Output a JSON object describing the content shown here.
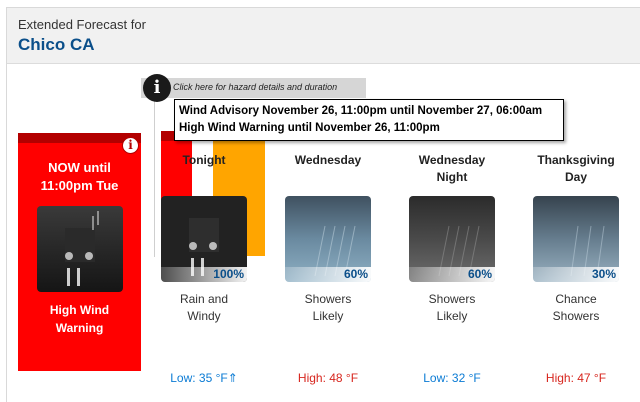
{
  "header": {
    "title_small": "Extended Forecast for",
    "title_big": "Chico CA"
  },
  "hazard": {
    "tab_text": "Click here for hazard details and duration",
    "popup_lines": [
      "Wind Advisory November 26, 11:00pm until November 27, 06:00am",
      "High Wind Warning until November 26, 11:00pm"
    ],
    "icon": "info-icon"
  },
  "now": {
    "title": "NOW until 11:00pm Tue",
    "title_l1": "NOW until",
    "title_l2": "11:00pm Tue",
    "desc_l1": "High Wind",
    "desc_l2": "Warning",
    "icon": "night-rain-icon",
    "color": "#ff0000"
  },
  "periods": [
    {
      "name_l1": "Tonight",
      "name_l2": "",
      "pop": "100%",
      "short_l1": "Rain and",
      "short_l2": "Windy",
      "temp": "Low: 35 °F⇑",
      "temp_type": "low"
    },
    {
      "name_l1": "Wednesday",
      "name_l2": "",
      "pop": "60%",
      "short_l1": "Showers",
      "short_l2": "Likely",
      "temp": "High: 48 °F",
      "temp_type": "high"
    },
    {
      "name_l1": "Wednesday",
      "name_l2": "Night",
      "pop": "60%",
      "short_l1": "Showers",
      "short_l2": "Likely",
      "temp": "Low: 32 °F",
      "temp_type": "low"
    },
    {
      "name_l1": "Thanksgiving",
      "name_l2": "Day",
      "pop": "30%",
      "short_l1": "Chance",
      "short_l2": "Showers",
      "temp": "High: 47 °F",
      "temp_type": "high"
    }
  ],
  "colors": {
    "high": "#d7261e",
    "low": "#0b7bd4",
    "warning": "#ff0000",
    "advisory": "#ffa500"
  }
}
